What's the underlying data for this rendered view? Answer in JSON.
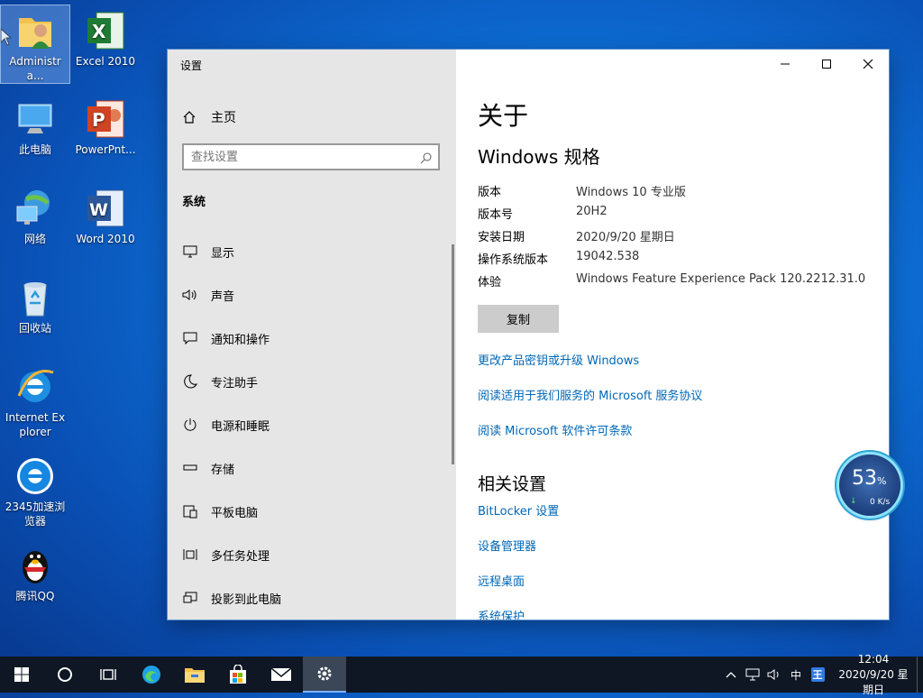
{
  "desktop": {
    "icons": [
      {
        "label": "Administra..."
      },
      {
        "label": "Excel 2010"
      },
      {
        "label": "此电脑"
      },
      {
        "label": "PowerPnt..."
      },
      {
        "label": "网络"
      },
      {
        "label": "Word 2010"
      },
      {
        "label": "回收站"
      },
      {
        "label": "Internet Explorer"
      },
      {
        "label": "2345加速浏览器"
      },
      {
        "label": "腾讯QQ"
      }
    ]
  },
  "window": {
    "title": "设置",
    "home_label": "主页",
    "search_placeholder": "查找设置",
    "section_label": "系统",
    "nav": [
      {
        "label": "显示",
        "icon": "display-icon"
      },
      {
        "label": "声音",
        "icon": "speaker-icon"
      },
      {
        "label": "通知和操作",
        "icon": "notification-icon"
      },
      {
        "label": "专注助手",
        "icon": "moon-icon"
      },
      {
        "label": "电源和睡眠",
        "icon": "power-icon"
      },
      {
        "label": "存储",
        "icon": "storage-icon"
      },
      {
        "label": "平板电脑",
        "icon": "tablet-icon"
      },
      {
        "label": "多任务处理",
        "icon": "multitask-icon"
      },
      {
        "label": "投影到此电脑",
        "icon": "project-icon"
      }
    ]
  },
  "content": {
    "title": "关于",
    "spec_heading": "Windows 规格",
    "specs": [
      {
        "key": "版本",
        "value": "Windows 10 专业版"
      },
      {
        "key": "版本号",
        "value": "20H2"
      },
      {
        "key": "安装日期",
        "value": "2020/9/20 星期日"
      },
      {
        "key": "操作系统版本",
        "value": "19042.538"
      },
      {
        "key": "体验",
        "value": "Windows Feature Experience Pack 120.2212.31.0"
      }
    ],
    "copy_button": "复制",
    "links": [
      "更改产品密钥或升级 Windows",
      "阅读适用于我们服务的 Microsoft 服务协议",
      "阅读 Microsoft 软件许可条款"
    ],
    "related_heading": "相关设置",
    "related_links": [
      "BitLocker 设置",
      "设备管理器",
      "远程桌面",
      "系统保护"
    ]
  },
  "speed_widget": {
    "percent": "53",
    "percent_unit": "%",
    "rate": "0 K/s"
  },
  "taskbar": {
    "tray_ime": "中",
    "tray_ime2": "王",
    "time": "12:04",
    "date": "2020/9/20 星期日"
  },
  "colors": {
    "accent": "#0067b8",
    "taskbar": "#0e1723",
    "pane": "#e6e6e6"
  }
}
